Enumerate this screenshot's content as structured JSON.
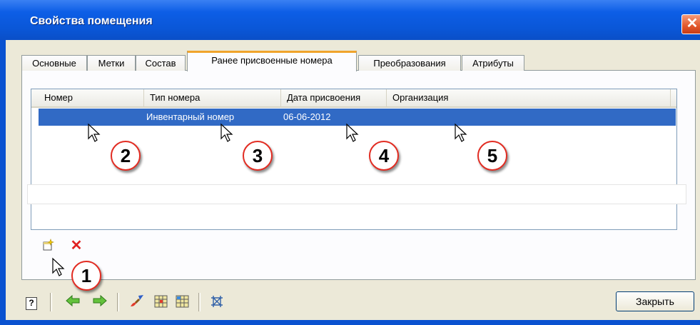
{
  "window": {
    "title": "Свойства помещения",
    "close_glyph": "✕"
  },
  "tabs": [
    {
      "label": "Основные",
      "active": false
    },
    {
      "label": "Метки",
      "active": false
    },
    {
      "label": "Состав",
      "active": false
    },
    {
      "label": "Ранее присвоенные номера",
      "active": true
    },
    {
      "label": "Преобразования",
      "active": false
    },
    {
      "label": "Атрибуты",
      "active": false
    }
  ],
  "table": {
    "columns": [
      "Номер",
      "Тип номера",
      "Дата присвоения",
      "Организация"
    ],
    "rows": [
      {
        "number": "",
        "type": "Инвентарный номер",
        "date": "06-06-2012",
        "organization": "",
        "selected": true
      }
    ]
  },
  "row_actions": {
    "add_icon": "new-record-icon",
    "delete_icon": "delete-x-icon",
    "delete_glyph": "✕"
  },
  "toolbar": {
    "help_glyph": "?",
    "icons": [
      "help-icon",
      "back-arrow-icon",
      "forward-arrow-icon",
      "brush-icon",
      "grid-edit-icon",
      "grid-select-icon",
      "grid-frame-icon"
    ],
    "close_label": "Закрыть"
  },
  "callouts": [
    "1",
    "2",
    "3",
    "4",
    "5"
  ],
  "colors": {
    "title_bar": "#0a57d8",
    "selection": "#316ac5",
    "tab_highlight": "#f0a42c",
    "callout_border": "#e22c22",
    "dialog_bg": "#ece9d8"
  }
}
